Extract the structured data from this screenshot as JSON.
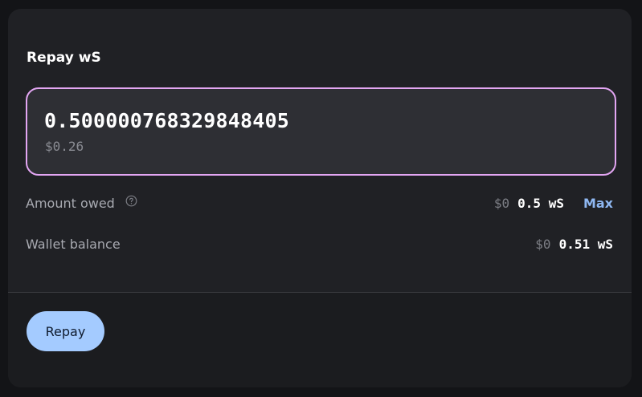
{
  "panel": {
    "title": "Repay wS"
  },
  "amount_input": {
    "value": "0.500000768329848405",
    "usd_value": "$0.26"
  },
  "amount_owed": {
    "label": "Amount owed",
    "usd": "$0",
    "amount": "0.5 wS",
    "max_label": "Max"
  },
  "wallet_balance": {
    "label": "Wallet balance",
    "usd": "$0",
    "amount": "0.51 wS"
  },
  "footer": {
    "repay_label": "Repay"
  },
  "colors": {
    "input_border": "#e3a6f3",
    "button_bg": "#a4cbff",
    "max_link": "#8fb8f2"
  },
  "icons": {
    "help": "question-circle-icon"
  }
}
